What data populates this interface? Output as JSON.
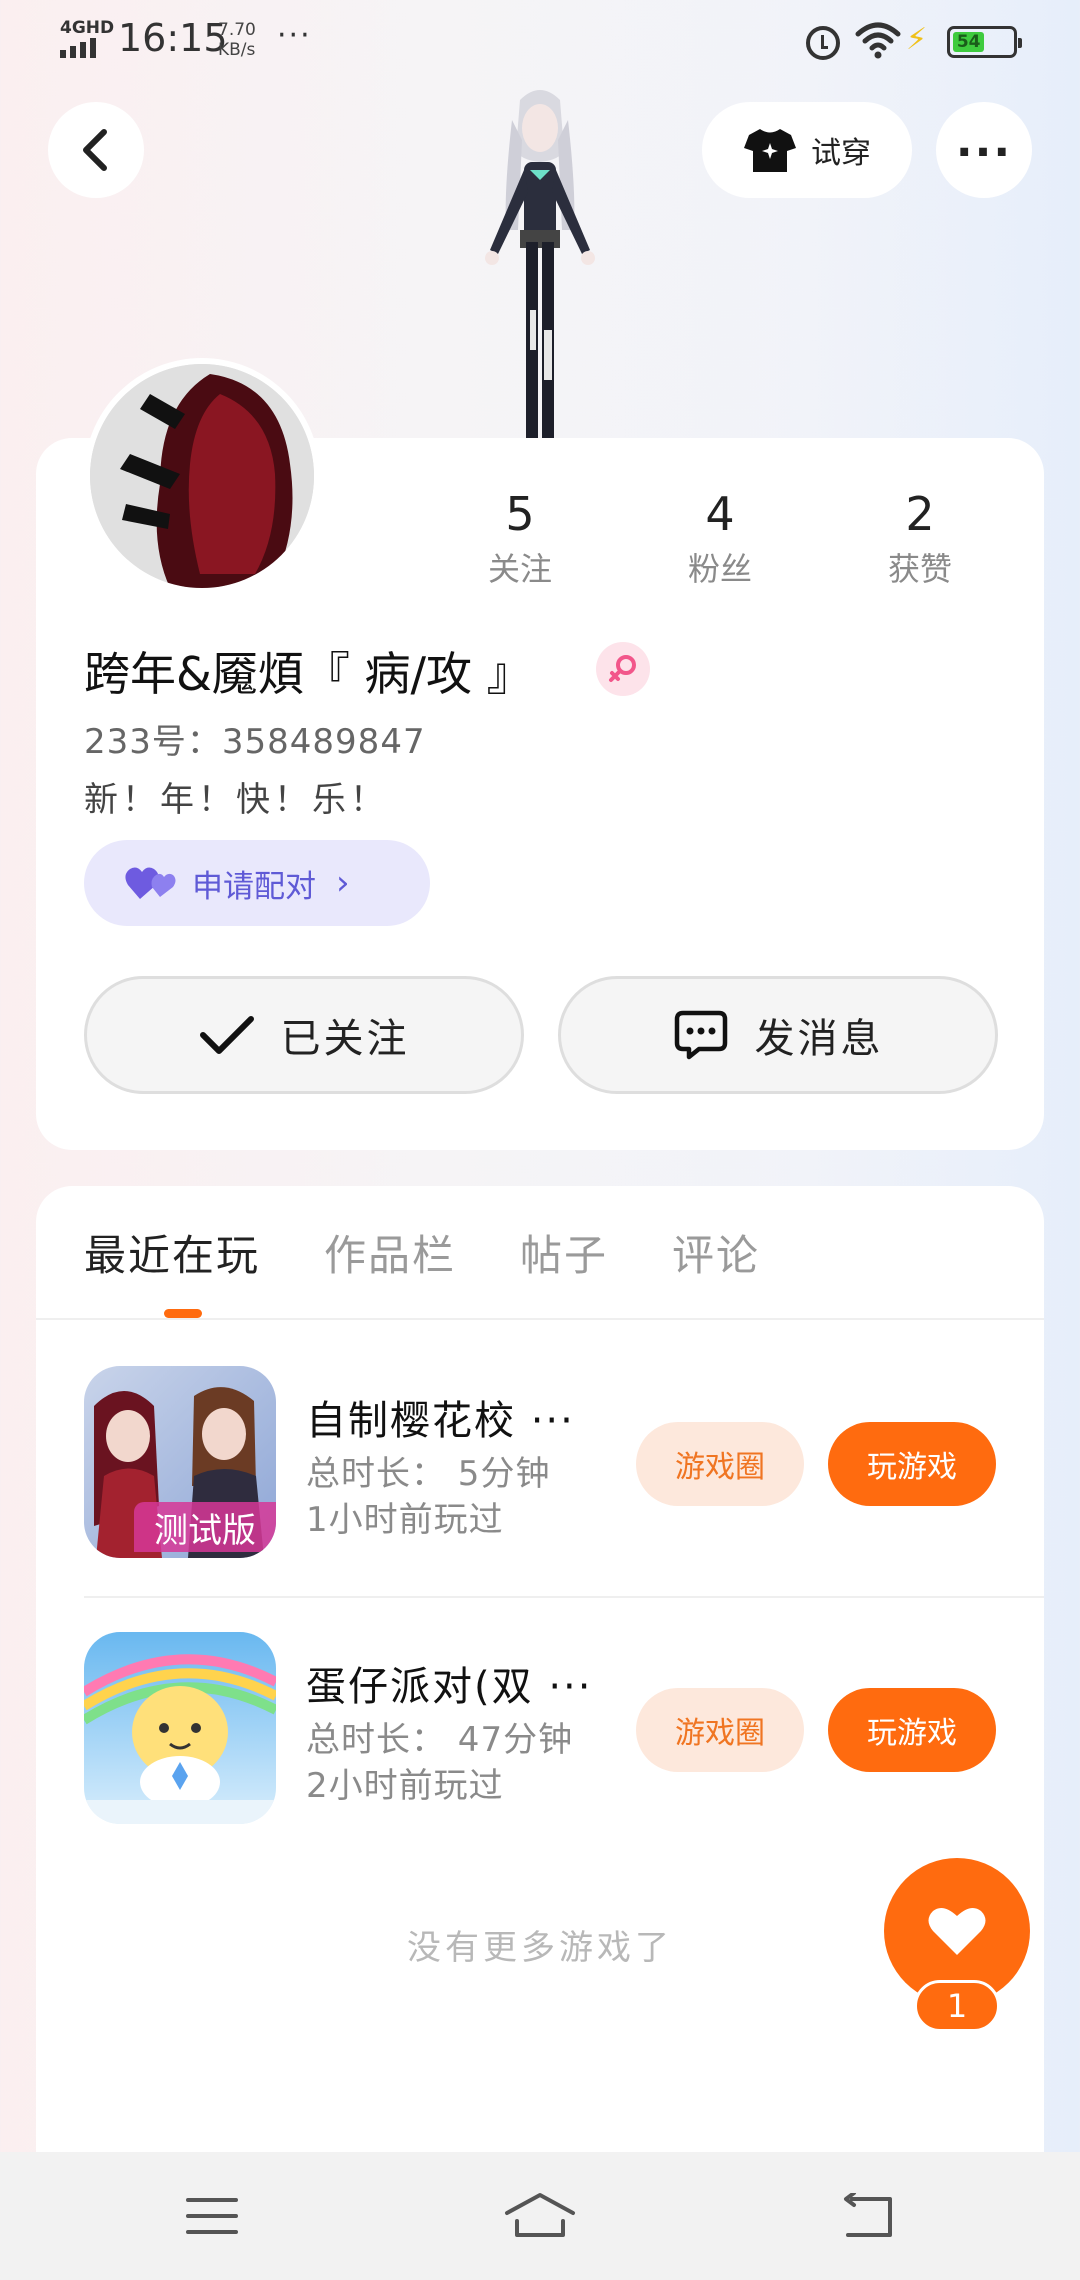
{
  "status_bar": {
    "network": "4GHD",
    "time": "16:15",
    "speed_value": "7.70",
    "speed_unit": "KB/s",
    "battery": "54"
  },
  "header": {
    "tryon_label": "试穿"
  },
  "profile": {
    "stats": [
      {
        "value": "5",
        "label": "关注"
      },
      {
        "value": "4",
        "label": "粉丝"
      },
      {
        "value": "2",
        "label": "获赞"
      }
    ],
    "username": "跨年&魇煩『 病/攻 』",
    "uid": "233号：358489847",
    "bio": "新！年！快！乐！",
    "pair_label": "申请配对",
    "follow_label": "已关注",
    "message_label": "发消息"
  },
  "tabs": [
    {
      "label": "最近在玩"
    },
    {
      "label": "作品栏"
    },
    {
      "label": "帖子"
    },
    {
      "label": "评论"
    }
  ],
  "games": [
    {
      "title": "自制樱花校 ···",
      "duration": "总时长： 5分钟",
      "last_played": "1小时前玩过",
      "badge": "测试版",
      "circle_label": "游戏圈",
      "play_label": "玩游戏"
    },
    {
      "title": "蛋仔派对(双 ···",
      "duration": "总时长： 47分钟",
      "last_played": "2小时前玩过",
      "circle_label": "游戏圈",
      "play_label": "玩游戏"
    }
  ],
  "footer": {
    "no_more": "没有更多游戏了"
  },
  "like_fab": {
    "count": "1"
  },
  "colors": {
    "accent": "#ff6b0f",
    "pair_purple": "#5f5ad6"
  }
}
